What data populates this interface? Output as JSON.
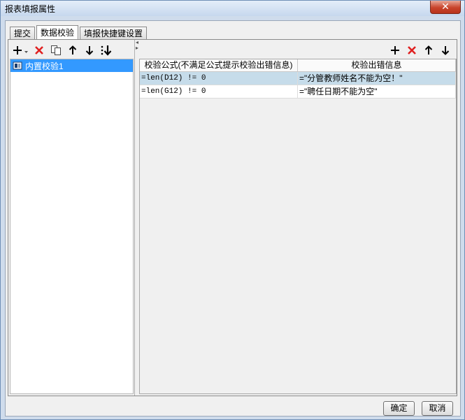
{
  "window": {
    "title": "报表填报属性",
    "close_label": "✕"
  },
  "tabs": [
    {
      "label": "提交",
      "active": false
    },
    {
      "label": "数据校验",
      "active": true
    },
    {
      "label": "填报快捷键设置",
      "active": false
    }
  ],
  "left_toolbar": [
    "add-dropdown",
    "delete",
    "copy",
    "move-up",
    "move-down",
    "move-bottom"
  ],
  "tree": {
    "items": [
      {
        "label": "内置校验1",
        "selected": true
      }
    ]
  },
  "right_toolbar": [
    "add",
    "delete",
    "move-up",
    "move-down"
  ],
  "grid": {
    "columns": [
      "校验公式(不满足公式提示校验出错信息)",
      "校验出错信息"
    ],
    "rows": [
      {
        "formula": "=len(D12) != 0",
        "message": "=\"分管教师姓名不能为空！\"",
        "selected": true
      },
      {
        "formula": "=len(G12) != 0",
        "message": "=\"聘任日期不能为空\"",
        "selected": false
      }
    ]
  },
  "buttons": {
    "ok": "确定",
    "cancel": "取消"
  },
  "colors": {
    "selection": "#3399ff",
    "row_selected": "#c6dcea",
    "delete_red": "#e02020"
  }
}
